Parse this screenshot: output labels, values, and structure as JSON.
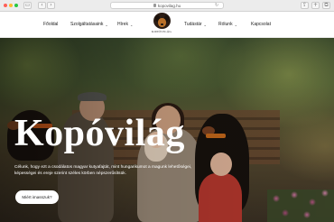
{
  "browser": {
    "url": "kopovilag.hu",
    "traffic_lights": [
      "#ff5f57",
      "#febc2e",
      "#28c840"
    ]
  },
  "header": {
    "logo_text": "KOPÓVILÁG",
    "menu": [
      {
        "label": "Főoldal"
      },
      {
        "label": "Szolgáltatásaink"
      },
      {
        "label": "Hírek"
      },
      {
        "label": "Tudástár"
      },
      {
        "label": "Rólunk"
      },
      {
        "label": "Kapcsolat"
      }
    ]
  },
  "hero": {
    "title": "Kopóvilág",
    "text": "Célunk, hogy ezt a csodálatos magyar kutyafajtát, mint hungarikumot a magunk lehetőségei, képességei és ereje szerint széles körben népszerűsítsük.",
    "button_label": "Miért imasszuk?"
  }
}
